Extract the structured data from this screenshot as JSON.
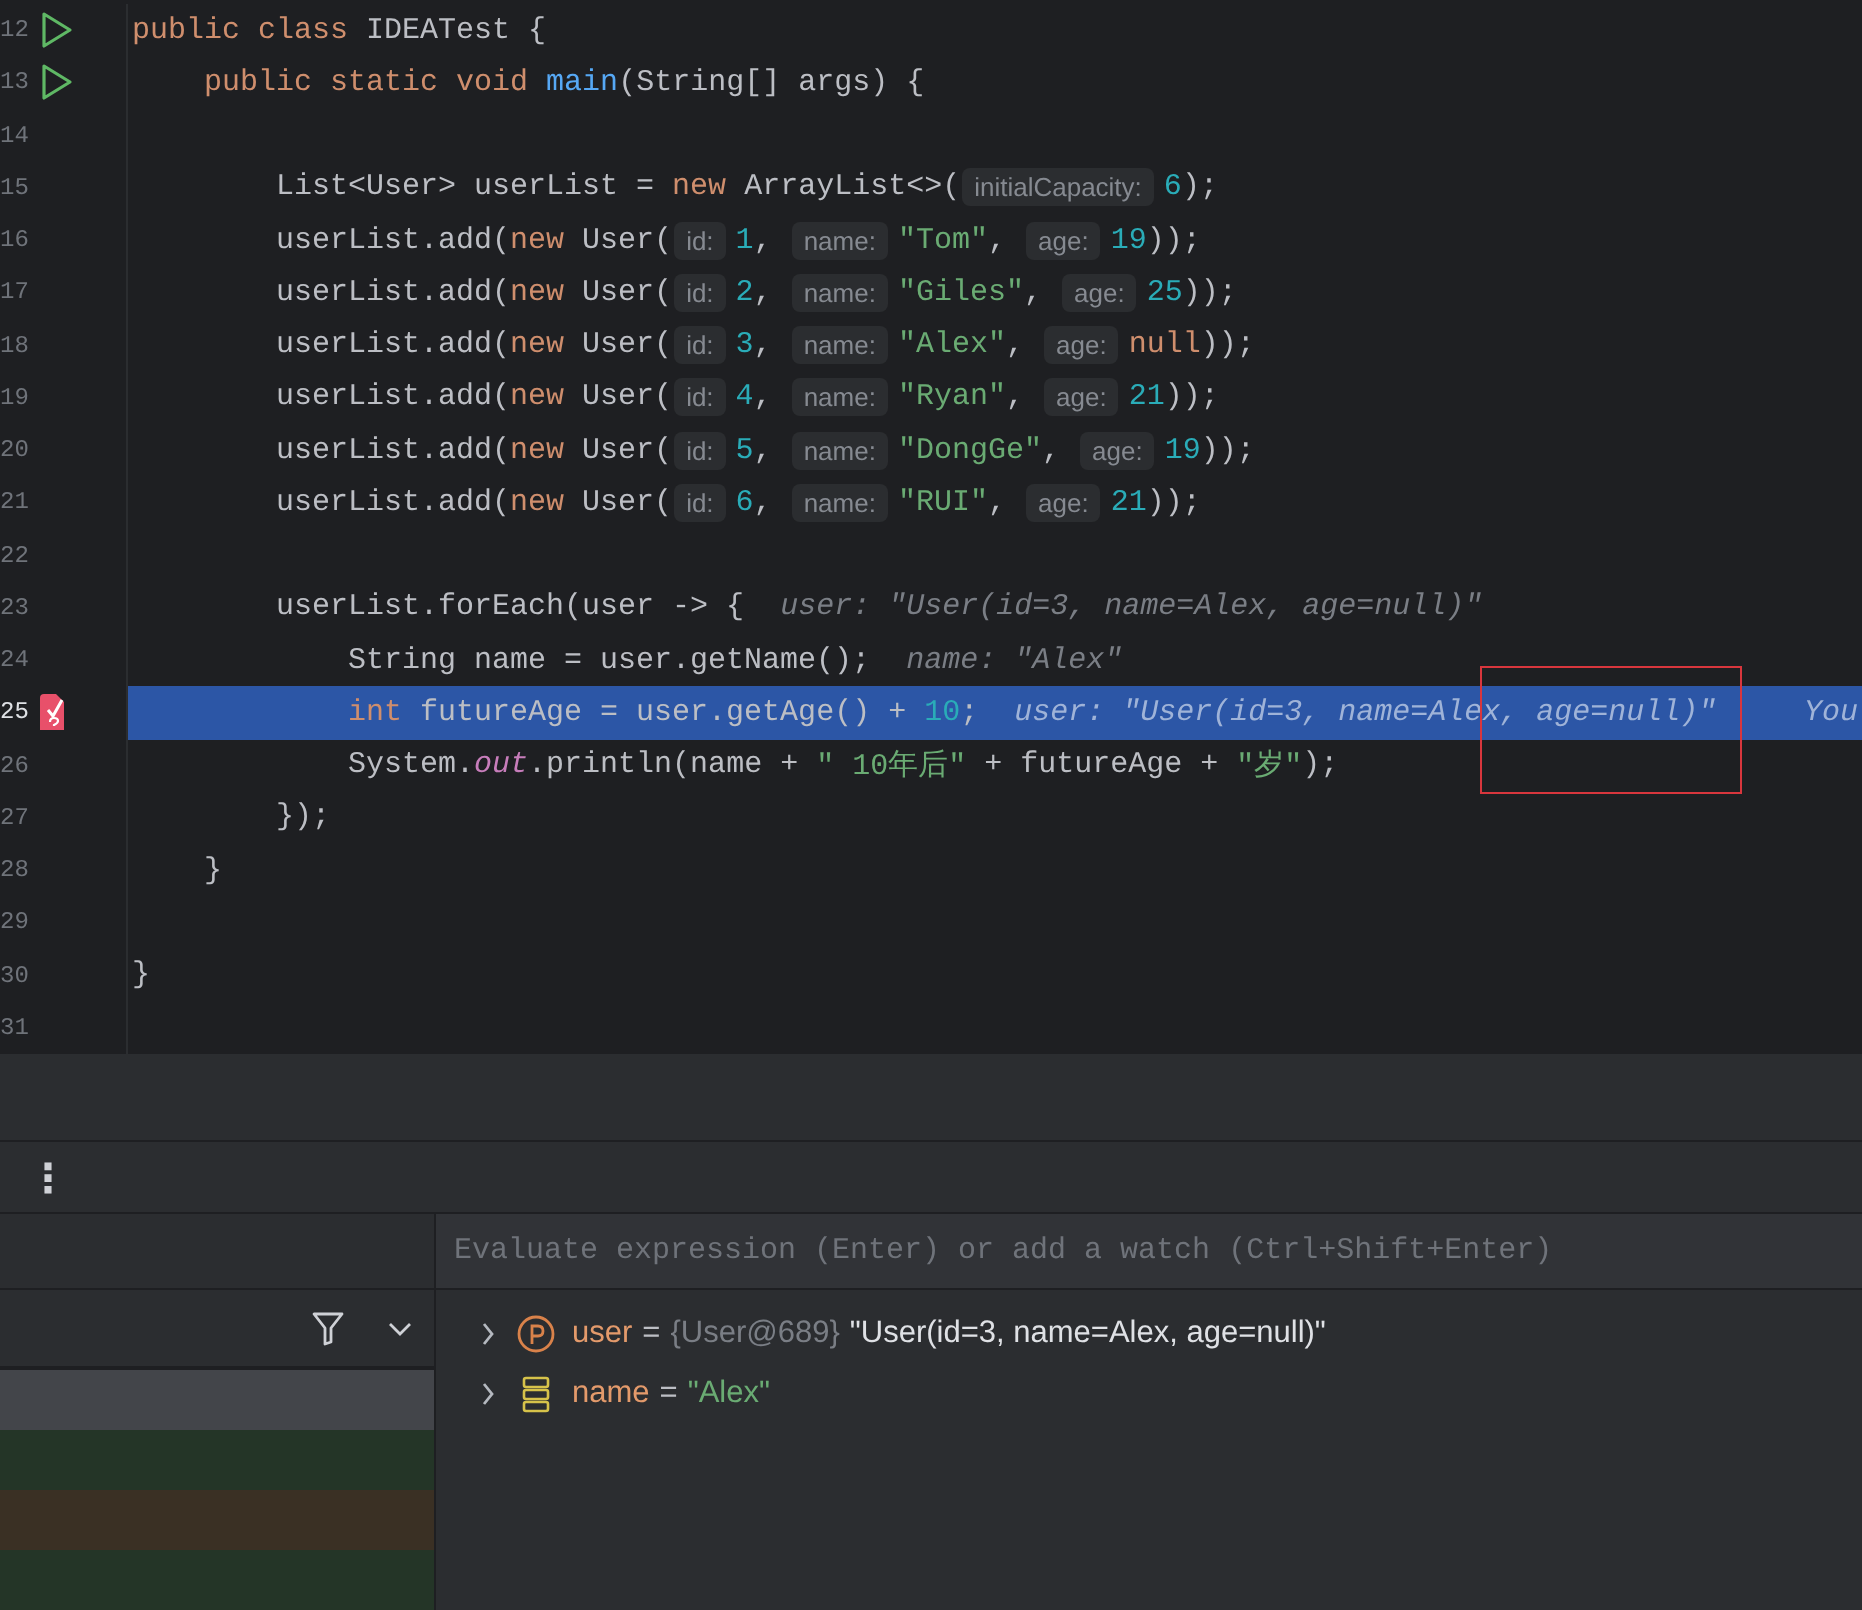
{
  "editor": {
    "lines": [
      {
        "number": "12",
        "runnable": true,
        "breakpoint": false,
        "current": false,
        "tokens": [
          {
            "kind": "keyword",
            "text": "public class "
          },
          {
            "kind": "plain",
            "text": "IDEATest {"
          }
        ]
      },
      {
        "number": "13",
        "runnable": true,
        "breakpoint": false,
        "current": false,
        "tokens": [
          {
            "kind": "keyword",
            "text": "    public static void "
          },
          {
            "kind": "function",
            "text": "main"
          },
          {
            "kind": "plain",
            "text": "(String[] args) {"
          }
        ]
      },
      {
        "number": "14",
        "runnable": false,
        "breakpoint": false,
        "current": false
      },
      {
        "number": "15",
        "runnable": false,
        "breakpoint": false,
        "current": false,
        "tokens": [
          {
            "kind": "plain",
            "text": "        List<User> userList = "
          },
          {
            "kind": "keyword",
            "text": "new "
          },
          {
            "kind": "plain",
            "text": "ArrayList<>("
          },
          {
            "kind": "hint",
            "text": "initialCapacity:"
          },
          {
            "kind": "number",
            "text": "6"
          },
          {
            "kind": "plain",
            "text": ");"
          }
        ]
      },
      {
        "number": "16",
        "runnable": false,
        "breakpoint": false,
        "current": false,
        "tokens": [
          {
            "kind": "plain",
            "text": "        userList.add("
          },
          {
            "kind": "keyword",
            "text": "new "
          },
          {
            "kind": "plain",
            "text": "User("
          },
          {
            "kind": "hint",
            "text": "id:"
          },
          {
            "kind": "number",
            "text": "1"
          },
          {
            "kind": "plain",
            "text": ", "
          },
          {
            "kind": "hint",
            "text": "name:"
          },
          {
            "kind": "string",
            "text": "\"Tom\""
          },
          {
            "kind": "plain",
            "text": ", "
          },
          {
            "kind": "hint",
            "text": "age:"
          },
          {
            "kind": "number",
            "text": "19"
          },
          {
            "kind": "plain",
            "text": "));"
          }
        ]
      },
      {
        "number": "17",
        "runnable": false,
        "breakpoint": false,
        "current": false,
        "tokens": [
          {
            "kind": "plain",
            "text": "        userList.add("
          },
          {
            "kind": "keyword",
            "text": "new "
          },
          {
            "kind": "plain",
            "text": "User("
          },
          {
            "kind": "hint",
            "text": "id:"
          },
          {
            "kind": "number",
            "text": "2"
          },
          {
            "kind": "plain",
            "text": ", "
          },
          {
            "kind": "hint",
            "text": "name:"
          },
          {
            "kind": "string",
            "text": "\"Giles\""
          },
          {
            "kind": "plain",
            "text": ", "
          },
          {
            "kind": "hint",
            "text": "age:"
          },
          {
            "kind": "number",
            "text": "25"
          },
          {
            "kind": "plain",
            "text": "));"
          }
        ]
      },
      {
        "number": "18",
        "runnable": false,
        "breakpoint": false,
        "current": false,
        "tokens": [
          {
            "kind": "plain",
            "text": "        userList.add("
          },
          {
            "kind": "keyword",
            "text": "new "
          },
          {
            "kind": "plain",
            "text": "User("
          },
          {
            "kind": "hint",
            "text": "id:"
          },
          {
            "kind": "number",
            "text": "3"
          },
          {
            "kind": "plain",
            "text": ", "
          },
          {
            "kind": "hint",
            "text": "name:"
          },
          {
            "kind": "string",
            "text": "\"Alex\""
          },
          {
            "kind": "plain",
            "text": ", "
          },
          {
            "kind": "hint",
            "text": "age:"
          },
          {
            "kind": "keyword",
            "text": "null"
          },
          {
            "kind": "plain",
            "text": "));"
          }
        ]
      },
      {
        "number": "19",
        "runnable": false,
        "breakpoint": false,
        "current": false,
        "tokens": [
          {
            "kind": "plain",
            "text": "        userList.add("
          },
          {
            "kind": "keyword",
            "text": "new "
          },
          {
            "kind": "plain",
            "text": "User("
          },
          {
            "kind": "hint",
            "text": "id:"
          },
          {
            "kind": "number",
            "text": "4"
          },
          {
            "kind": "plain",
            "text": ", "
          },
          {
            "kind": "hint",
            "text": "name:"
          },
          {
            "kind": "string",
            "text": "\"Ryan\""
          },
          {
            "kind": "plain",
            "text": ", "
          },
          {
            "kind": "hint",
            "text": "age:"
          },
          {
            "kind": "number",
            "text": "21"
          },
          {
            "kind": "plain",
            "text": "));"
          }
        ]
      },
      {
        "number": "20",
        "runnable": false,
        "breakpoint": false,
        "current": false,
        "tokens": [
          {
            "kind": "plain",
            "text": "        userList.add("
          },
          {
            "kind": "keyword",
            "text": "new "
          },
          {
            "kind": "plain",
            "text": "User("
          },
          {
            "kind": "hint",
            "text": "id:"
          },
          {
            "kind": "number",
            "text": "5"
          },
          {
            "kind": "plain",
            "text": ", "
          },
          {
            "kind": "hint",
            "text": "name:"
          },
          {
            "kind": "string",
            "text": "\"DongGe\""
          },
          {
            "kind": "plain",
            "text": ", "
          },
          {
            "kind": "hint",
            "text": "age:"
          },
          {
            "kind": "number",
            "text": "19"
          },
          {
            "kind": "plain",
            "text": "));"
          }
        ]
      },
      {
        "number": "21",
        "runnable": false,
        "breakpoint": false,
        "current": false,
        "tokens": [
          {
            "kind": "plain",
            "text": "        userList.add("
          },
          {
            "kind": "keyword",
            "text": "new "
          },
          {
            "kind": "plain",
            "text": "User("
          },
          {
            "kind": "hint",
            "text": "id:"
          },
          {
            "kind": "number",
            "text": "6"
          },
          {
            "kind": "plain",
            "text": ", "
          },
          {
            "kind": "hint",
            "text": "name:"
          },
          {
            "kind": "string",
            "text": "\"RUI\""
          },
          {
            "kind": "plain",
            "text": ", "
          },
          {
            "kind": "hint",
            "text": "age:"
          },
          {
            "kind": "number",
            "text": "21"
          },
          {
            "kind": "plain",
            "text": "));"
          }
        ]
      },
      {
        "number": "22",
        "runnable": false,
        "breakpoint": false,
        "current": false
      },
      {
        "number": "23",
        "runnable": false,
        "breakpoint": false,
        "current": false,
        "tokens": [
          {
            "kind": "plain",
            "text": "        userList.forEach(user -> {"
          },
          {
            "kind": "inlay",
            "text": "user: \"User(id=3, name=Alex, age=null)\""
          }
        ]
      },
      {
        "number": "24",
        "runnable": false,
        "breakpoint": false,
        "current": false,
        "tokens": [
          {
            "kind": "plain",
            "text": "            String name = user.getName();"
          },
          {
            "kind": "inlay",
            "text": "name: \"Alex\""
          }
        ]
      },
      {
        "number": "25",
        "runnable": false,
        "breakpoint": true,
        "current": true,
        "tokens": [
          {
            "kind": "keyword",
            "text": "            int "
          },
          {
            "kind": "plain",
            "text": "futureAge = user.getAge() + "
          },
          {
            "kind": "number",
            "text": "10"
          },
          {
            "kind": "plain",
            "text": ";"
          },
          {
            "kind": "inlay",
            "text": "user: \"User(id=3, name=Ale"
          },
          {
            "kind": "inlay-boxed",
            "text": "x, age=null)\""
          },
          {
            "kind": "trailing",
            "text": "You"
          }
        ]
      },
      {
        "number": "26",
        "runnable": false,
        "breakpoint": false,
        "current": false,
        "tokens": [
          {
            "kind": "plain",
            "text": "            System."
          },
          {
            "kind": "field",
            "text": "out"
          },
          {
            "kind": "plain",
            "text": ".println(name + "
          },
          {
            "kind": "string",
            "text": "\" 10年后\""
          },
          {
            "kind": "plain",
            "text": " + futureAge + "
          },
          {
            "kind": "string",
            "text": "\"岁\""
          },
          {
            "kind": "plain",
            "text": ");"
          }
        ]
      },
      {
        "number": "27",
        "runnable": false,
        "breakpoint": false,
        "current": false,
        "tokens": [
          {
            "kind": "plain",
            "text": "        });"
          }
        ]
      },
      {
        "number": "28",
        "runnable": false,
        "breakpoint": false,
        "current": false,
        "tokens": [
          {
            "kind": "plain",
            "text": "    }"
          }
        ]
      },
      {
        "number": "29",
        "runnable": false,
        "breakpoint": false,
        "current": false
      },
      {
        "number": "30",
        "runnable": false,
        "breakpoint": false,
        "current": false,
        "tokens": [
          {
            "kind": "plain",
            "text": "}"
          }
        ]
      },
      {
        "number": "31",
        "runnable": false,
        "breakpoint": false,
        "current": false
      }
    ]
  },
  "debug_toolbar": {
    "more_button": "⋮"
  },
  "frames": [
    {
      "selected": true
    },
    {
      "selected": false,
      "color": "#243527"
    },
    {
      "selected": false,
      "color": "#3a3024"
    },
    {
      "selected": false,
      "color": "#243527"
    }
  ],
  "evaluate_field": {
    "placeholder": "Evaluate expression (Enter) or add a watch (Ctrl+Shift+Enter)"
  },
  "variables": [
    {
      "kind": "parameter",
      "name": "user",
      "operator": "=",
      "type": "{User@689}",
      "value": "\"User(id=3, name=Alex, age=null)\"",
      "expanded": false
    },
    {
      "kind": "local",
      "name": "name",
      "operator": "=",
      "value": "\"Alex\"",
      "expanded": false
    }
  ]
}
